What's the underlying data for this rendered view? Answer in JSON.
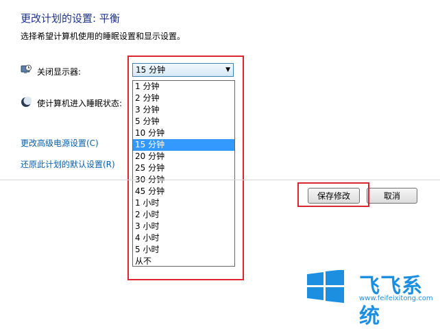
{
  "header": {
    "title": "更改计划的设置: 平衡",
    "subtitle": "选择希望计算机使用的睡眠设置和显示设置。"
  },
  "settings": {
    "display": {
      "label": "关闭显示器:",
      "icon": "monitor-clock-icon",
      "selected": "15 分钟"
    },
    "sleep": {
      "label": "使计算机进入睡眠状态:",
      "icon": "moon-sleep-icon"
    }
  },
  "dropdown": {
    "options": [
      "1 分钟",
      "2 分钟",
      "3 分钟",
      "5 分钟",
      "10 分钟",
      "15 分钟",
      "20 分钟",
      "25 分钟",
      "30 分钟",
      "45 分钟",
      "1 小时",
      "2 小时",
      "3 小时",
      "4 小时",
      "5 小时",
      "从不"
    ],
    "selected_index": 5
  },
  "links": {
    "advanced": "更改高级电源设置(C)",
    "restore": "还原此计划的默认设置(R)"
  },
  "buttons": {
    "save": "保存修改",
    "cancel": "取消"
  },
  "watermark": {
    "brand": "飞飞系统",
    "url": "www.feifeixitong.com"
  },
  "colors": {
    "highlight": "#3399ff",
    "frame": "#d9262e",
    "link": "#0b5ea8"
  }
}
